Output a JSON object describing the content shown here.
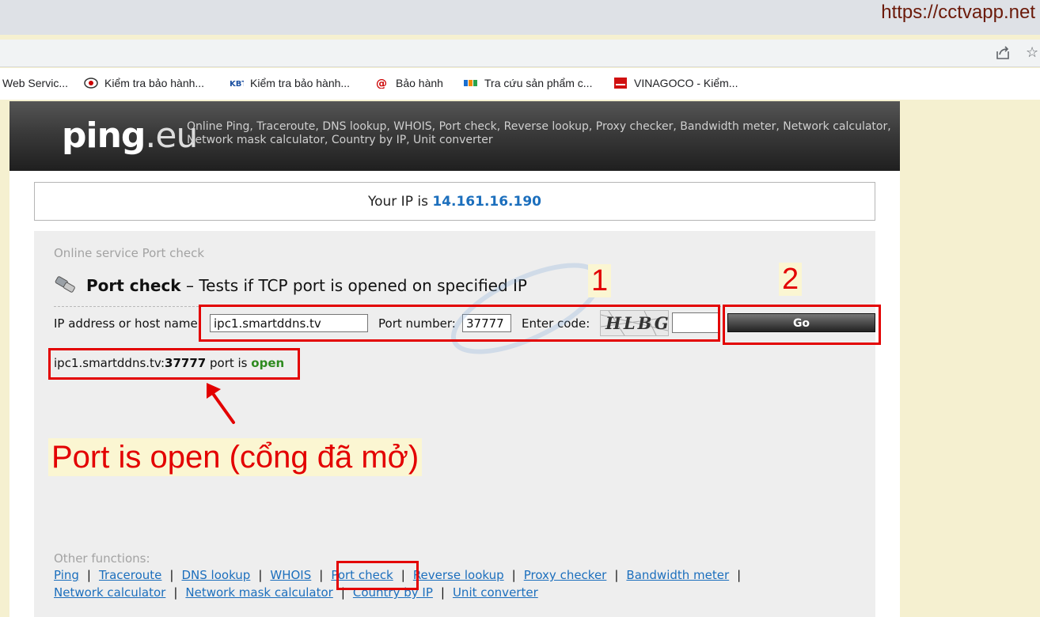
{
  "browser": {
    "watermark_url": "https://cctvapp.net",
    "bookmarks": [
      {
        "label": "Web Servic...",
        "icon": "none"
      },
      {
        "label": "Kiểm tra bảo hành...",
        "icon": "eye-icon"
      },
      {
        "label": "Kiểm tra bảo hành...",
        "icon": "kbt-icon"
      },
      {
        "label": "Bảo hành",
        "icon": "at-icon"
      },
      {
        "label": "Tra cứu sản phẩm c...",
        "icon": "fpt-icon"
      },
      {
        "label": "VINAGOCO - Kiểm...",
        "icon": "vinagoco-icon"
      }
    ]
  },
  "site": {
    "logo_main": "ping",
    "logo_suffix": ".eu",
    "description": "Online Ping, Traceroute, DNS lookup, WHOIS, Port check, Reverse lookup, Proxy checker, Bandwidth meter, Network calculator, Network mask calculator, Country by IP, Unit converter",
    "your_ip_label": "Your IP is",
    "your_ip": "14.161.16.190"
  },
  "service": {
    "label": "Online service Port check",
    "title_bold": "Port check",
    "title_rest": " – Tests if TCP port is opened on specified IP",
    "host_label": "IP address or host name:",
    "host_value": "ipc1.smartddns.tv",
    "port_label": "Port number:",
    "port_value": "37777",
    "code_label": "Enter code:",
    "captcha_text": "HLBG",
    "code_value": "",
    "go_label": "Go"
  },
  "result": {
    "host": "ipc1.smartddns.tv:",
    "port": "37777",
    "middle": " port is ",
    "status": "open"
  },
  "other_functions": {
    "label": "Other functions:",
    "row1": [
      "Ping",
      "Traceroute",
      "DNS lookup",
      "WHOIS",
      "Port check",
      "Reverse lookup",
      "Proxy checker",
      "Bandwidth meter"
    ],
    "row2": [
      "Network calculator",
      "Network mask calculator",
      "Country by IP",
      "Unit converter"
    ]
  },
  "annotations": {
    "step1": "1",
    "step2": "2",
    "caption": "Port is open (cổng đã mở)",
    "color": "#e30000"
  }
}
